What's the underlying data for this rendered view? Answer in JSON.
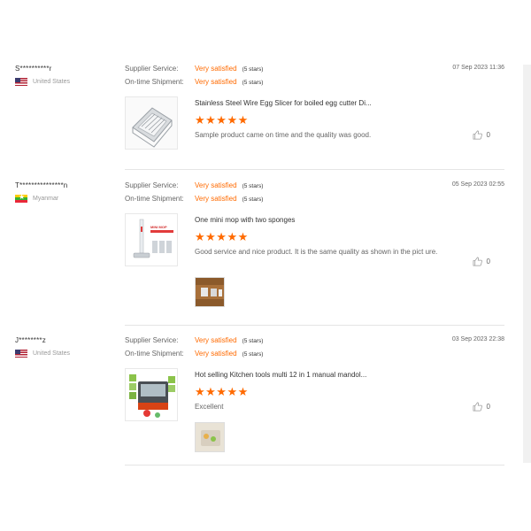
{
  "labels": {
    "supplier_service": "Supplier Service:",
    "ontime_shipment": "On-time Shipment:"
  },
  "reviews": [
    {
      "buyer": "S**********r",
      "country": "United States",
      "flag": "us-flag",
      "supplier_rating": "Very satisfied",
      "supplier_stars": "(5 stars)",
      "shipment_rating": "Very satisfied",
      "shipment_stars": "(5 stars)",
      "date": "07 Sep 2023 11:36",
      "product_title": "Stainless Steel Wire Egg Slicer for boiled egg cutter Di...",
      "stars": "★★★★★",
      "comment": "Sample product came on time and the quality was good.",
      "likes": "0"
    },
    {
      "buyer": "T***************n",
      "country": "Myanmar",
      "flag": "myanmar-flag",
      "supplier_rating": "Very satisfied",
      "supplier_stars": "(5 stars)",
      "shipment_rating": "Very satisfied",
      "shipment_stars": "(5 stars)",
      "date": "05 Sep 2023 02:55",
      "product_title": "One mini mop with two sponges",
      "stars": "★★★★★",
      "comment": "Good service and nice product. It is the same quality as shown in the pict ure.",
      "likes": "0",
      "thumb_text": "MINI MOP"
    },
    {
      "buyer": "J********z",
      "country": "United States",
      "flag": "us-flag",
      "supplier_rating": "Very satisfied",
      "supplier_stars": "(5 stars)",
      "shipment_rating": "Very satisfied",
      "shipment_stars": "(5 stars)",
      "date": "03 Sep 2023 22:38",
      "product_title": "Hot selling Kitchen tools multi 12 in 1 manual mandol...",
      "stars": "★★★★★",
      "comment": "Excellent",
      "likes": "0"
    }
  ],
  "colors": {
    "accent": "#ff6a00",
    "divider": "#e5e5e5"
  }
}
